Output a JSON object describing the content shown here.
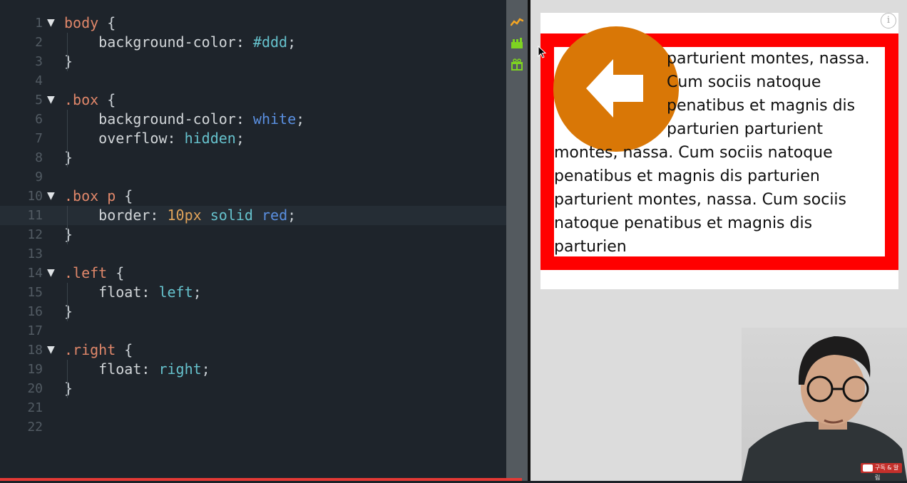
{
  "editor": {
    "lines": [
      {
        "n": "1",
        "fold": "▼",
        "tokens": [
          {
            "t": "body",
            "c": "tk-sel"
          },
          {
            "t": " {",
            "c": "tk-brace"
          }
        ]
      },
      {
        "n": "2",
        "fold": "",
        "tokens": [
          {
            "t": "    background-color: ",
            "c": "tk-prop"
          },
          {
            "t": "#ddd",
            "c": "tk-val"
          },
          {
            "t": ";",
            "c": "tk-brace"
          }
        ]
      },
      {
        "n": "3",
        "fold": "",
        "tokens": [
          {
            "t": "}",
            "c": "tk-brace"
          }
        ]
      },
      {
        "n": "4",
        "fold": "",
        "tokens": []
      },
      {
        "n": "5",
        "fold": "▼",
        "tokens": [
          {
            "t": ".box",
            "c": "tk-sel"
          },
          {
            "t": " {",
            "c": "tk-brace"
          }
        ]
      },
      {
        "n": "6",
        "fold": "",
        "tokens": [
          {
            "t": "    background-color: ",
            "c": "tk-prop"
          },
          {
            "t": "white",
            "c": "tk-kw"
          },
          {
            "t": ";",
            "c": "tk-brace"
          }
        ]
      },
      {
        "n": "7",
        "fold": "",
        "tokens": [
          {
            "t": "    overflow: ",
            "c": "tk-prop"
          },
          {
            "t": "hidden",
            "c": "tk-val"
          },
          {
            "t": ";",
            "c": "tk-brace"
          }
        ]
      },
      {
        "n": "8",
        "fold": "",
        "tokens": [
          {
            "t": "}",
            "c": "tk-brace"
          }
        ]
      },
      {
        "n": "9",
        "fold": "",
        "tokens": []
      },
      {
        "n": "10",
        "fold": "▼",
        "tokens": [
          {
            "t": ".box ",
            "c": "tk-sel"
          },
          {
            "t": "p",
            "c": "tk-sel"
          },
          {
            "t": " {",
            "c": "tk-brace"
          }
        ]
      },
      {
        "n": "11",
        "fold": "",
        "active": true,
        "tokens": [
          {
            "t": "    border: ",
            "c": "tk-prop"
          },
          {
            "t": "10px",
            "c": "tk-num"
          },
          {
            "t": " ",
            "c": "tk-prop"
          },
          {
            "t": "solid",
            "c": "tk-val"
          },
          {
            "t": " ",
            "c": "tk-prop"
          },
          {
            "t": "red",
            "c": "tk-kw"
          },
          {
            "t": ";",
            "c": "tk-brace"
          }
        ]
      },
      {
        "n": "12",
        "fold": "",
        "tokens": [
          {
            "t": "}",
            "c": "tk-brace"
          }
        ]
      },
      {
        "n": "13",
        "fold": "",
        "tokens": []
      },
      {
        "n": "14",
        "fold": "▼",
        "tokens": [
          {
            "t": ".left",
            "c": "tk-sel"
          },
          {
            "t": " {",
            "c": "tk-brace"
          }
        ]
      },
      {
        "n": "15",
        "fold": "",
        "tokens": [
          {
            "t": "    float: ",
            "c": "tk-prop"
          },
          {
            "t": "left",
            "c": "tk-val"
          },
          {
            "t": ";",
            "c": "tk-brace"
          }
        ]
      },
      {
        "n": "16",
        "fold": "",
        "tokens": [
          {
            "t": "}",
            "c": "tk-brace"
          }
        ]
      },
      {
        "n": "17",
        "fold": "",
        "tokens": []
      },
      {
        "n": "18",
        "fold": "▼",
        "tokens": [
          {
            "t": ".right",
            "c": "tk-sel"
          },
          {
            "t": " {",
            "c": "tk-brace"
          }
        ]
      },
      {
        "n": "19",
        "fold": "",
        "tokens": [
          {
            "t": "    float: ",
            "c": "tk-prop"
          },
          {
            "t": "right",
            "c": "tk-val"
          },
          {
            "t": ";",
            "c": "tk-brace"
          }
        ]
      },
      {
        "n": "20",
        "fold": "",
        "tokens": [
          {
            "t": "}",
            "c": "tk-brace"
          }
        ]
      },
      {
        "n": "21",
        "fold": "",
        "tokens": []
      },
      {
        "n": "22",
        "fold": "",
        "tokens": []
      }
    ]
  },
  "toolbar": {
    "icons": [
      "activity-icon",
      "animation-icon",
      "gift-icon"
    ],
    "colors": {
      "activity": "#f5a623",
      "animation": "#7ed321",
      "gift": "#7ed321"
    }
  },
  "preview": {
    "info_icon": "i",
    "paragraph_lines": [
      "parturient montes, nassa.",
      "Cum sociis natoque",
      "penatibus et magnis dis",
      "parturien parturient",
      "montes, nassa. Cum sociis natoque",
      "penatibus et magnis dis parturien",
      "parturient montes, nassa. Cum sociis",
      "natoque penatibus et magnis dis",
      "parturien"
    ],
    "circle_color": "#d97706",
    "border_color": "#ff0000"
  },
  "overlay": {
    "subscribe_label": "구독 & 알림"
  }
}
